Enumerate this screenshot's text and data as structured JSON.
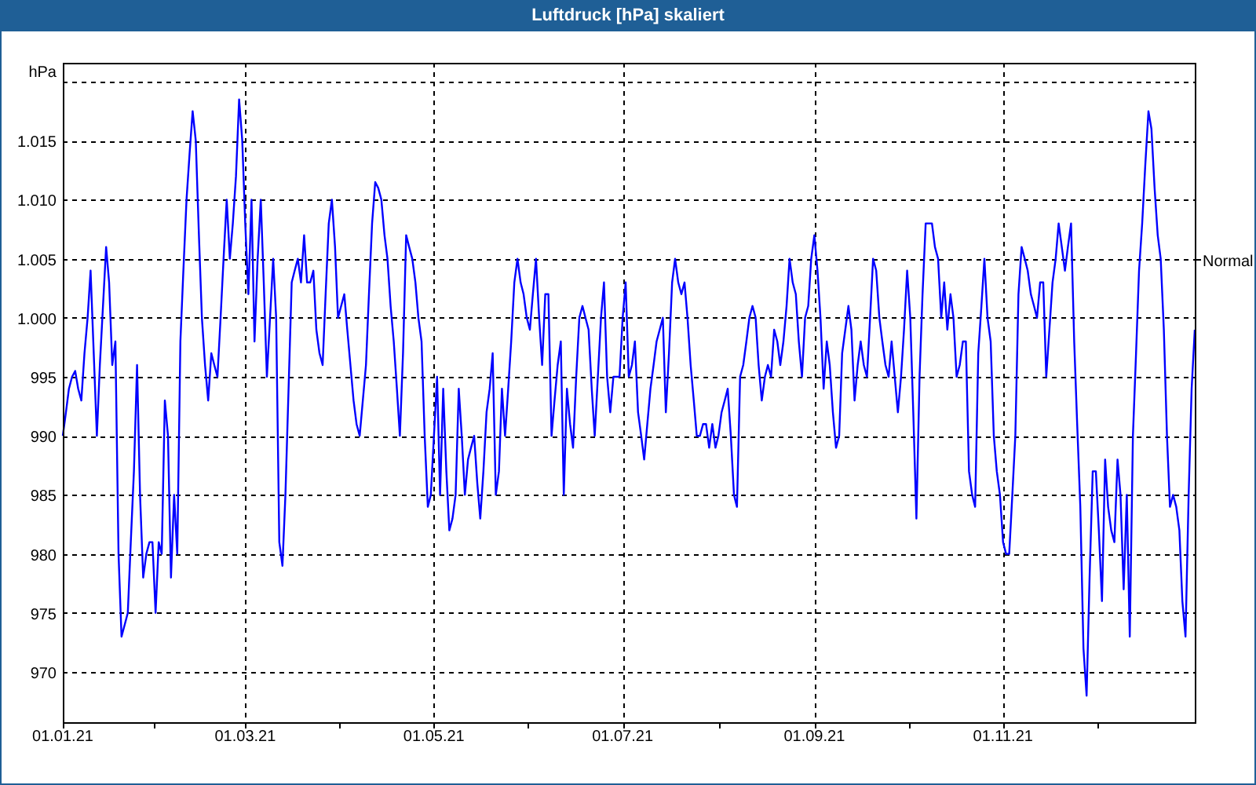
{
  "window": {
    "title": "Luftdruck [hPa] skaliert"
  },
  "chart": {
    "chart_data": {
      "type": "line",
      "ylabel": "hPa",
      "categories": [
        "01.01.21",
        null,
        null,
        null,
        null,
        null,
        null,
        null,
        null,
        null,
        null,
        null,
        null,
        null,
        null,
        null,
        null,
        null,
        null,
        null,
        null,
        null,
        null,
        null,
        null,
        null,
        null,
        null,
        null,
        null,
        null,
        null,
        null,
        null,
        null,
        null,
        null,
        null,
        null,
        null,
        null,
        null,
        null,
        null,
        null,
        null,
        null,
        null,
        null,
        null,
        null,
        null,
        null,
        null,
        null,
        null,
        null,
        null,
        null,
        "01.03.21",
        null,
        null,
        null,
        null,
        null,
        null,
        null,
        null,
        null,
        null,
        null,
        null,
        null,
        null,
        null,
        null,
        null,
        null,
        null,
        null,
        null,
        null,
        null,
        null,
        null,
        null,
        null,
        null,
        null,
        null,
        null,
        null,
        null,
        null,
        null,
        null,
        null,
        null,
        null,
        null,
        null,
        null,
        null,
        null,
        null,
        null,
        null,
        null,
        null,
        null,
        null,
        null,
        null,
        null,
        null,
        null,
        null,
        null,
        null,
        null,
        "01.05.21",
        null,
        null,
        null,
        null,
        null,
        null,
        null,
        null,
        null,
        null,
        null,
        null,
        null,
        null,
        null,
        null,
        null,
        null,
        null,
        null,
        null,
        null,
        null,
        null,
        null,
        null,
        null,
        null,
        null,
        null,
        null,
        null,
        null,
        null,
        null,
        null,
        null,
        null,
        null,
        null,
        null,
        null,
        null,
        null,
        null,
        null,
        null,
        null,
        null,
        null,
        null,
        null,
        null,
        null,
        null,
        null,
        null,
        null,
        null,
        null,
        "01.07.21",
        null,
        null,
        null,
        null,
        null,
        null,
        null,
        null,
        null,
        null,
        null,
        null,
        null,
        null,
        null,
        null,
        null,
        null,
        null,
        null,
        null,
        null,
        null,
        null,
        null,
        null,
        null,
        null,
        null,
        null,
        null,
        null,
        null,
        null,
        null,
        null,
        null,
        null,
        null,
        null,
        null,
        null,
        null,
        null,
        null,
        null,
        null,
        null,
        null,
        null,
        null,
        null,
        null,
        null,
        null,
        null,
        null,
        null,
        null,
        null,
        null,
        "01.09.21",
        null,
        null,
        null,
        null,
        null,
        null,
        null,
        null,
        null,
        null,
        null,
        null,
        null,
        null,
        null,
        null,
        null,
        null,
        null,
        null,
        null,
        null,
        null,
        null,
        null,
        null,
        null,
        null,
        null,
        null,
        null,
        null,
        null,
        null,
        null,
        null,
        null,
        null,
        null,
        null,
        null,
        null,
        null,
        null,
        null,
        null,
        null,
        null,
        null,
        null,
        null,
        null,
        null,
        null,
        null,
        null,
        null,
        null,
        null,
        null,
        "01.11.21",
        null,
        null,
        null,
        null,
        null,
        null,
        null,
        null,
        null,
        null,
        null,
        null,
        null,
        null,
        null,
        null,
        null,
        null,
        null,
        null,
        null,
        null,
        null,
        null,
        null,
        null,
        null,
        null,
        null,
        null,
        null,
        null,
        null,
        null,
        null,
        null,
        null,
        null,
        null,
        null,
        null,
        null,
        null,
        null,
        null,
        null,
        null,
        null,
        null,
        null,
        null,
        null,
        null,
        null,
        null,
        null,
        null,
        null,
        null,
        null,
        null,
        null
      ],
      "series": [
        {
          "color": "#0000ff",
          "values": [
            990,
            992,
            994,
            995,
            995.5,
            994,
            993,
            997,
            1000,
            1004,
            997,
            990,
            996,
            1001,
            1006,
            1003,
            996,
            998,
            980,
            973,
            974,
            975,
            981,
            987,
            996,
            985,
            978,
            980,
            981,
            981,
            975,
            981,
            980,
            993,
            990,
            978,
            985,
            980,
            998,
            1004,
            1010,
            1014,
            1017.5,
            1015,
            1007,
            1000,
            996,
            993,
            997,
            996,
            995,
            1000,
            1005,
            1010,
            1005,
            1008,
            1012,
            1018.5,
            1015,
            1008,
            1002,
            1010,
            998,
            1005,
            1010,
            1003,
            995,
            1000,
            1005,
            1000,
            981,
            979,
            985,
            994,
            1003,
            1004,
            1005,
            1003,
            1007,
            1003,
            1003,
            1004,
            999,
            997,
            996,
            1002,
            1008,
            1010,
            1006,
            1000,
            1001,
            1002,
            999,
            996,
            993,
            991,
            990,
            993,
            996,
            1002,
            1008,
            1011.5,
            1011,
            1010,
            1007,
            1005,
            1001,
            998,
            994,
            990,
            997,
            1007,
            1006,
            1005,
            1003,
            1000,
            998,
            990,
            984,
            985,
            990,
            995,
            985,
            994,
            987,
            982,
            983,
            985,
            994,
            990,
            985,
            988,
            989,
            990,
            986,
            983,
            987,
            992,
            994,
            997,
            985,
            987,
            994,
            990,
            994,
            998,
            1003,
            1005,
            1003,
            1002,
            1000,
            999,
            1002,
            1005,
            1000,
            996,
            1002,
            1002,
            990,
            993,
            996,
            998,
            985,
            994,
            991,
            989,
            995,
            1000,
            1001,
            1000,
            999,
            994,
            990,
            995,
            1000,
            1003,
            995,
            992,
            995,
            995,
            995,
            1000,
            1003,
            995,
            996,
            998,
            992,
            990,
            988,
            991,
            994,
            996,
            998,
            999,
            1000,
            992,
            997,
            1003,
            1005,
            1003,
            1002,
            1003,
            1000,
            996,
            993,
            990,
            990,
            991,
            991,
            989,
            991,
            989,
            990,
            992,
            993,
            994,
            990,
            985,
            984,
            995,
            996,
            998,
            1000,
            1001,
            1000,
            996,
            993,
            995,
            996,
            995,
            999,
            998,
            996,
            998,
            1001,
            1005,
            1003,
            1002,
            998,
            995,
            1000,
            1001,
            1005,
            1007,
            1004,
            1000,
            994,
            998,
            996,
            992,
            989,
            990,
            997,
            999,
            1001,
            999,
            993,
            996,
            998,
            996,
            995,
            1000,
            1005,
            1004,
            1000,
            998,
            996,
            995,
            998,
            995,
            992,
            995,
            999,
            1004,
            1000,
            992,
            983,
            995,
            1002,
            1008,
            1008,
            1008,
            1006,
            1005,
            1000,
            1003,
            999,
            1002,
            1000,
            995,
            996,
            998,
            998,
            987,
            985,
            984,
            997,
            1001,
            1005,
            1000,
            998,
            990,
            987,
            985,
            981,
            980,
            980,
            985,
            990,
            1002,
            1006,
            1005,
            1004,
            1002,
            1001,
            1000,
            1003,
            1003,
            995,
            999,
            1003,
            1005,
            1008,
            1006,
            1004,
            1006,
            1008,
            998,
            991,
            984,
            972,
            968,
            978,
            987,
            987,
            982,
            976,
            988,
            984,
            982,
            981,
            988,
            985,
            977,
            985,
            973,
            990,
            997,
            1004,
            1008,
            1013,
            1017.5,
            1016,
            1011,
            1007,
            1005,
            999,
            990,
            984,
            985,
            984,
            982,
            976,
            973,
            985,
            994,
            999
          ]
        }
      ],
      "ylim": [
        965.75,
        1021.6
      ],
      "yticks": [
        {
          "value": 970,
          "label": "970"
        },
        {
          "value": 975,
          "label": "975"
        },
        {
          "value": 980,
          "label": "980"
        },
        {
          "value": 985,
          "label": "985"
        },
        {
          "value": 990,
          "label": "990"
        },
        {
          "value": 995,
          "label": "995"
        },
        {
          "value": 1000,
          "label": "1.000"
        },
        {
          "value": 1005,
          "label": "1.005"
        },
        {
          "value": 1010,
          "label": "1.010"
        },
        {
          "value": 1015,
          "label": "1.015"
        }
      ],
      "grid": true,
      "annotations": [
        "Normal"
      ]
    }
  }
}
